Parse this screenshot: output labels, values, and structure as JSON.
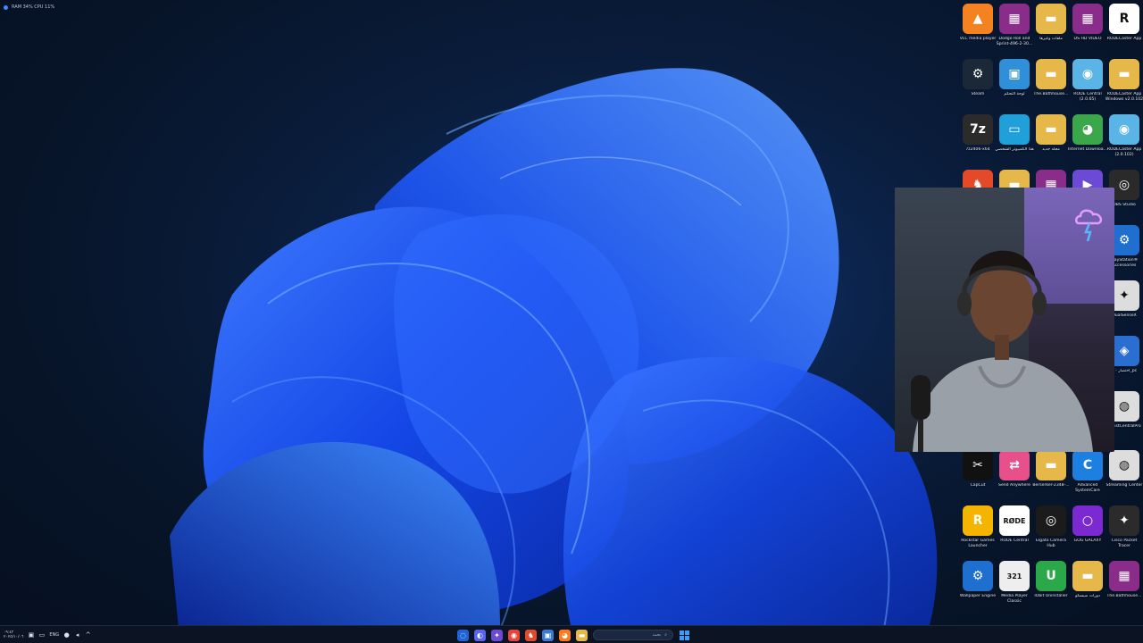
{
  "perf_overlay": {
    "text": "RAM 34%  CPU 11%"
  },
  "desktop_icons": [
    {
      "id": "vlc",
      "label": "VLC media player",
      "color": "#f58220",
      "glyph": "▲"
    },
    {
      "id": "dodge",
      "label": "Dodge Roll and Sprint-496-2-30...",
      "color": "#8a2d8a",
      "glyph": "▦"
    },
    {
      "id": "folder-ar1",
      "label": "ملفات وغيرها",
      "color": "#e6b84a",
      "glyph": "▬"
    },
    {
      "id": "ds-hd-video",
      "label": "DS HD VIDEO",
      "color": "#8a2d8a",
      "glyph": "▦"
    },
    {
      "id": "rodecaster-app",
      "label": "RODECaster App",
      "color": "#ffffff",
      "glyph": "R"
    },
    {
      "id": "steam",
      "label": "Steam",
      "color": "#1b2838",
      "glyph": "⚙"
    },
    {
      "id": "control-panel",
      "label": "لوحة التحكم",
      "color": "#2f8fd9",
      "glyph": "▣"
    },
    {
      "id": "bathhouse1",
      "label": "The.Bathhouse...",
      "color": "#e6b84a",
      "glyph": "▬"
    },
    {
      "id": "rode-central",
      "label": "RODE Central (2.0.65)",
      "color": "#5ab4e6",
      "glyph": "◉"
    },
    {
      "id": "rodecaster-win",
      "label": "RODECaster App Windows v2.0.102",
      "color": "#e6b84a",
      "glyph": "▬"
    },
    {
      "id": "7zip",
      "label": "7z2406-x64",
      "color": "#2b2b2b",
      "glyph": "7z"
    },
    {
      "id": "this-pc",
      "label": "هذا الكمبيوتر الشخصي",
      "color": "#1fa0d8",
      "glyph": "▭"
    },
    {
      "id": "new-folder",
      "label": "مجلد جديد",
      "color": "#e6b84a",
      "glyph": "▬"
    },
    {
      "id": "idm",
      "label": "Internet Downloa...",
      "color": "#3aa84a",
      "glyph": "◕"
    },
    {
      "id": "rodecaster-app2",
      "label": "RODECaster App (2.0.102)",
      "color": "#5ab4e6",
      "glyph": "◉"
    },
    {
      "id": "brave",
      "label": "",
      "color": "#e24a2a",
      "glyph": "♞"
    },
    {
      "id": "folder-y",
      "label": "",
      "color": "#e6b84a",
      "glyph": "▬"
    },
    {
      "id": "winrar",
      "label": "",
      "color": "#8a2d8a",
      "glyph": "▦"
    },
    {
      "id": "media-a",
      "label": "",
      "color": "#6c4ad6",
      "glyph": "▶"
    },
    {
      "id": "obs",
      "label": "OBS Studio",
      "color": "#2a2a2a",
      "glyph": "◎"
    },
    {
      "id": "ps-acc",
      "label": "PlayStation® Accessories",
      "color": "#1f6fd0",
      "glyph": "⚙"
    },
    {
      "id": "dualsense",
      "label": "DualSenseX",
      "color": "#dddddd",
      "glyph": "✦"
    },
    {
      "id": "cliparts",
      "label": "اختصار - 2_pc",
      "color": "#2a6fd0",
      "glyph": "◈"
    },
    {
      "id": "assist-central",
      "label": "AssistCentralPro",
      "color": "#dddddd",
      "glyph": "◍"
    },
    {
      "id": "capcut",
      "label": "CapCut",
      "color": "#111111",
      "glyph": "✂"
    },
    {
      "id": "send-anywhere",
      "label": "Send Anywhere",
      "color": "#e8508c",
      "glyph": "⇄"
    },
    {
      "id": "berserker",
      "label": "Berserker-2348-...",
      "color": "#e6b84a",
      "glyph": "▬"
    },
    {
      "id": "advanced-sc",
      "label": "Advanced SystemCare",
      "color": "#1d7fe0",
      "glyph": "C"
    },
    {
      "id": "streaming-center",
      "label": "Streaming Center",
      "color": "#dddddd",
      "glyph": "◍"
    },
    {
      "id": "rockstar",
      "label": "Rockstar Games Launcher",
      "color": "#f5b400",
      "glyph": "R"
    },
    {
      "id": "rode-central2",
      "label": "RODE Central",
      "color": "#ffffff",
      "glyph": "RØDE"
    },
    {
      "id": "elgato",
      "label": "Elgato Camera Hub",
      "color": "#1b1b1b",
      "glyph": "◎"
    },
    {
      "id": "gog",
      "label": "GOG GALAXY",
      "color": "#7a2ad0",
      "glyph": "○"
    },
    {
      "id": "cisco",
      "label": "Cisco Packet Tracer",
      "color": "#2b2b2b",
      "glyph": "✦"
    },
    {
      "id": "wallpaper-engine",
      "label": "Wallpaper Engine",
      "color": "#1f6fd0",
      "glyph": "⚙"
    },
    {
      "id": "mpc",
      "label": "Media Player Classic",
      "color": "#eeeeee",
      "glyph": "321"
    },
    {
      "id": "iobit",
      "label": "IObit Uninstaller",
      "color": "#2aa84a",
      "glyph": "U"
    },
    {
      "id": "folder-ar2",
      "label": "دورات سيسكو",
      "color": "#e6b84a",
      "glyph": "▬"
    },
    {
      "id": "bathhouse2",
      "label": "The.Bathhouse...",
      "color": "#8a2d8a",
      "glyph": "▦"
    }
  ],
  "taskbar": {
    "lang": "ENG",
    "clock_time": "٠٩:٤٣",
    "clock_date": "٢٠٢٥/١٠/٠٦",
    "search_placeholder": "بحث",
    "apps": [
      {
        "id": "copilot",
        "color": "#1e63d8",
        "glyph": "◌"
      },
      {
        "id": "discord",
        "color": "#5865f2",
        "glyph": "◐"
      },
      {
        "id": "app-purple",
        "color": "#6c4ad6",
        "glyph": "✦"
      },
      {
        "id": "chrome",
        "color": "#e8443a",
        "glyph": "◉"
      },
      {
        "id": "brave",
        "color": "#e24a2a",
        "glyph": "♞"
      },
      {
        "id": "store",
        "color": "#3a7bd5",
        "glyph": "▣"
      },
      {
        "id": "firefox",
        "color": "#ff7a1a",
        "glyph": "◕"
      },
      {
        "id": "explorer",
        "color": "#e6b84a",
        "glyph": "▬"
      }
    ]
  }
}
